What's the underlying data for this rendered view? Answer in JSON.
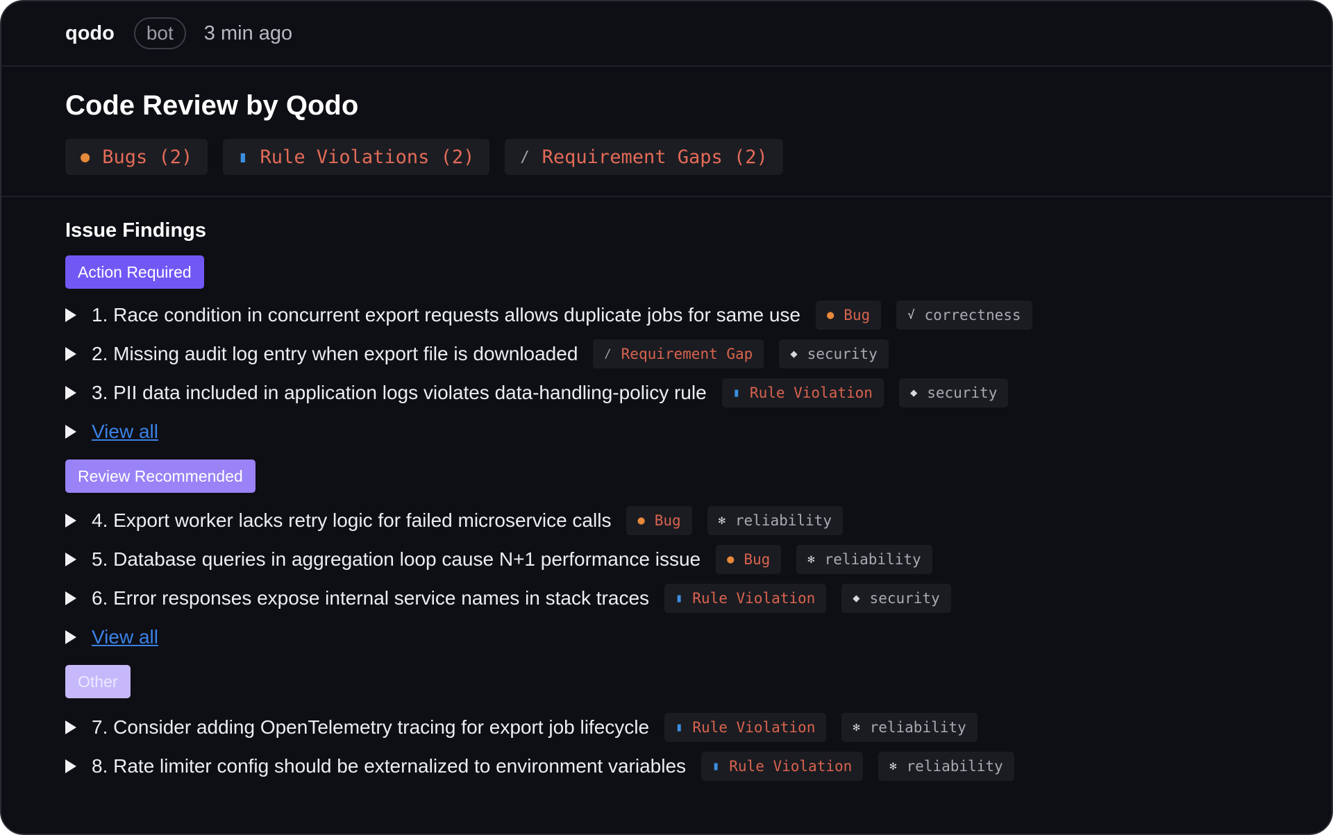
{
  "header": {
    "author": "qodo",
    "badge": "bot",
    "time": "3 min ago"
  },
  "summary": {
    "title": "Code Review by Qodo",
    "chips": [
      {
        "label": "Bugs (2)",
        "icon": "bug-icon"
      },
      {
        "label": "Rule Violations (2)",
        "icon": "book-icon"
      },
      {
        "label": "Requirement Gaps (2)",
        "icon": "paperclip-icon"
      }
    ]
  },
  "findings": {
    "heading": "Issue Findings",
    "groups": [
      {
        "label": "Action Required",
        "items": [
          {
            "text": "1. Race condition in concurrent export requests allows duplicate jobs for same use",
            "type": "Bug",
            "type_icon": "bug-icon",
            "category": "correctness",
            "category_icon": "check-icon"
          },
          {
            "text": "2. Missing audit log entry when export file is downloaded",
            "type": "Requirement Gap",
            "type_icon": "paperclip-icon",
            "category": "security",
            "category_icon": "diamond-icon"
          },
          {
            "text": "3. PII data included in application logs violates data-handling-policy rule",
            "type": "Rule Violation",
            "type_icon": "book-icon",
            "category": "security",
            "category_icon": "diamond-icon"
          }
        ],
        "view_all": "View all"
      },
      {
        "label": "Review Recommended",
        "items": [
          {
            "text": "4. Export worker lacks retry logic for failed microservice calls",
            "type": "Bug",
            "type_icon": "bug-icon",
            "category": "reliability",
            "category_icon": "gear-icon"
          },
          {
            "text": "5. Database queries in aggregation loop cause N+1 performance issue",
            "type": "Bug",
            "type_icon": "bug-icon",
            "category": "reliability",
            "category_icon": "gear-icon"
          },
          {
            "text": "6. Error responses expose internal service names in stack traces",
            "type": "Rule Violation",
            "type_icon": "book-icon",
            "category": "security",
            "category_icon": "diamond-icon"
          }
        ],
        "view_all": "View all"
      },
      {
        "label": "Other",
        "items": [
          {
            "text": "7. Consider adding OpenTelemetry tracing for export job lifecycle",
            "type": "Rule Violation",
            "type_icon": "book-icon",
            "category": "reliability",
            "category_icon": "gear-icon"
          },
          {
            "text": "8. Rate limiter config should be externalized to environment variables",
            "type": "Rule Violation",
            "type_icon": "book-icon",
            "category": "reliability",
            "category_icon": "gear-icon"
          }
        ]
      }
    ]
  },
  "colors": {
    "background": "#0e0f14",
    "action_required": "#7158f5",
    "review_recommended": "#9a82f7",
    "other": "#c6b8fb",
    "tag_text": "#d9634f",
    "link": "#3b82e6"
  }
}
